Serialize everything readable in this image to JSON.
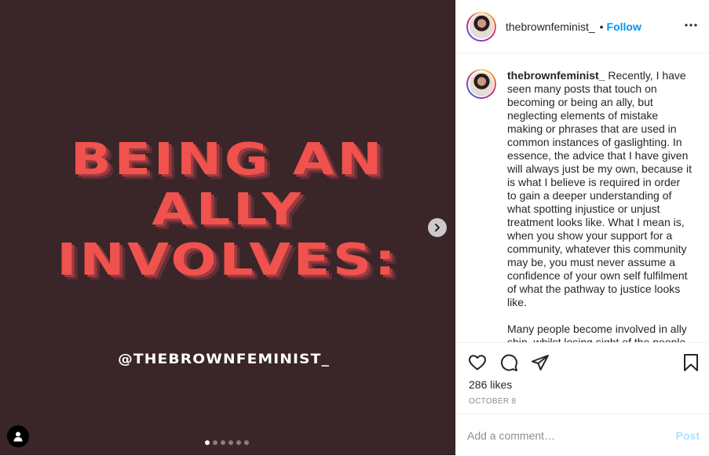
{
  "media": {
    "headline_lines": [
      "BEING AN",
      "ALLY",
      "INVOLVES:"
    ],
    "handle": "@THEBROWNFEMINIST_",
    "background_color": "#3a2529",
    "headline_color": "#f0524d",
    "carousel_slide_count": 6,
    "carousel_active_index": 0,
    "next_icon": "chevron-right-icon",
    "tag_icon": "user-tag-icon"
  },
  "header": {
    "username": "thebrownfeminist_",
    "separator": "•",
    "follow_label": "Follow",
    "more_icon": "more-horizontal-icon"
  },
  "caption": {
    "username": "thebrownfeminist_",
    "paragraph_1": "Recently, I have seen many posts that touch on becoming or being an ally, but neglecting elements of mistake making or phrases that are used in common instances of gaslighting. In essence, the advice that I have given will always just be my own, because it is what I believe is required in order to gain a deeper understanding of what spotting injustice or unjust treatment looks like. What I mean is, when you show your support for a community, whatever this community may be, you must never assume a confidence of your own self fulfilment of what the pathway to justice looks like.",
    "paragraph_2": "Many people become involved in ally ship, whilst losing sight of the people"
  },
  "actions": {
    "like_icon": "heart-icon",
    "comment_icon": "comment-icon",
    "share_icon": "share-icon",
    "save_icon": "bookmark-icon",
    "likes_text": "286 likes",
    "date": "OCTOBER 8"
  },
  "comment": {
    "placeholder": "Add a comment…",
    "post_label": "Post"
  },
  "colors": {
    "accent": "#0095f6",
    "post_disabled": "#b2dffc"
  }
}
